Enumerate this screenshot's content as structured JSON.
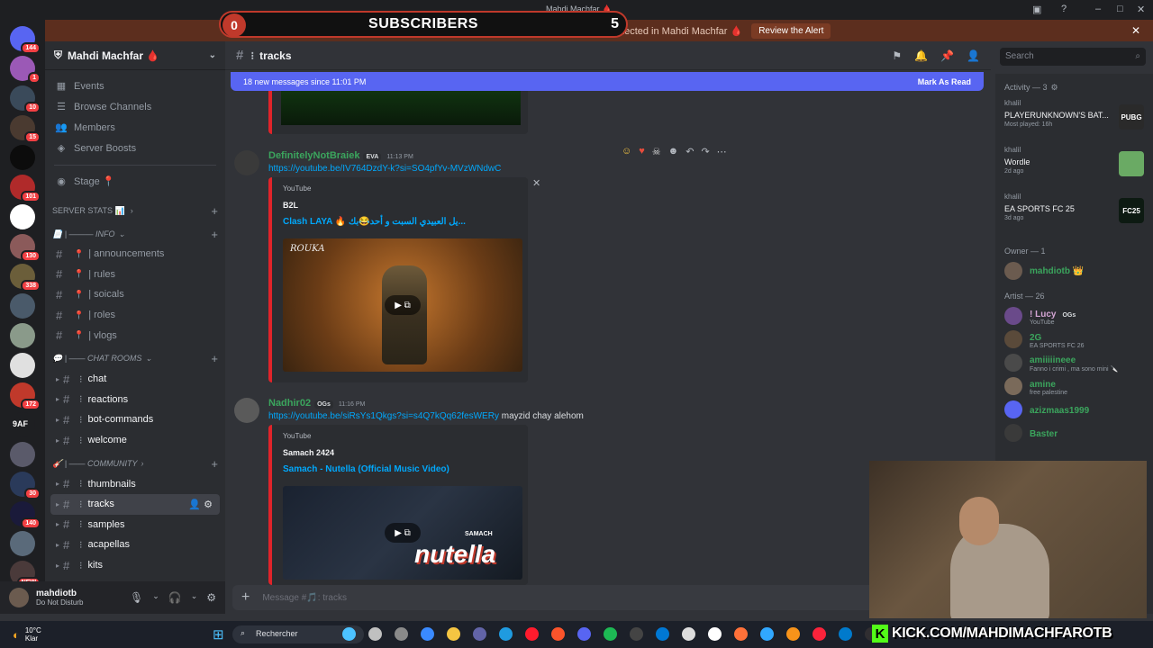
{
  "subscriber_overlay": {
    "left_count": "0",
    "label": "SUBSCRIBERS",
    "right_count": "5"
  },
  "window": {
    "title": "Mahdi Machfar 🩸"
  },
  "alert": {
    "text": "Unusual join activity detected in Mahdi Machfar 🩸",
    "action": "Review the Alert"
  },
  "servers": [
    {
      "badge": "144",
      "color": "#5865f2"
    },
    {
      "badge": "1",
      "color": "#9b59b6"
    },
    {
      "badge": "10",
      "color": "#3a4a5a"
    },
    {
      "badge": "15",
      "color": "#4a3a30"
    },
    {
      "badge": "",
      "color": "#0c0c0c"
    },
    {
      "badge": "101",
      "color": "#b02a2a"
    },
    {
      "badge": "",
      "color": "#ffffff"
    },
    {
      "badge": "130",
      "color": "#8b5a5a"
    },
    {
      "badge": "338",
      "color": "#6b5e3a"
    },
    {
      "badge": "",
      "color": "#4a5a6a"
    },
    {
      "badge": "",
      "color": "#8a9a8a"
    },
    {
      "badge": "",
      "color": "#e0e0e0"
    },
    {
      "badge": "172",
      "color": "#c0392b"
    },
    {
      "badge": "",
      "color": "#1e1f22",
      "text": "9AF"
    },
    {
      "badge": "",
      "color": "#5a5a6a"
    },
    {
      "badge": "30",
      "color": "#2a3a5a"
    },
    {
      "badge": "140",
      "color": "#1a1a3a"
    },
    {
      "badge": "",
      "color": "#5a6a7a"
    },
    {
      "badge": "NEW",
      "color": "#4a3a3a"
    }
  ],
  "server_name": "Mahdi Machfar 🩸",
  "nav": [
    {
      "icon": "calendar",
      "label": "Events"
    },
    {
      "icon": "browse",
      "label": "Browse Channels"
    },
    {
      "icon": "members",
      "label": "Members"
    },
    {
      "icon": "boost",
      "label": "Server Boosts"
    }
  ],
  "stage": {
    "label": "Stage 📍"
  },
  "server_stats": {
    "label": "SERVER STATS 📊"
  },
  "categories": {
    "info": "📄 | ——— INFO",
    "chat_rooms": "💬 | —— CHAT ROOMS",
    "community": "🎸 | —— COMMUNITY"
  },
  "info_channels": [
    {
      "label": "| announcements"
    },
    {
      "label": "| rules"
    },
    {
      "label": "| soicals"
    },
    {
      "label": "| roles"
    },
    {
      "label": "| vlogs"
    }
  ],
  "chat_channels": [
    {
      "label": "chat"
    },
    {
      "label": "reactions"
    },
    {
      "label": "bot-commands"
    },
    {
      "label": "welcome"
    }
  ],
  "community_channels": [
    {
      "label": "thumbnails"
    },
    {
      "label": "tracks"
    },
    {
      "label": "samples"
    },
    {
      "label": "acapellas"
    },
    {
      "label": "kits"
    }
  ],
  "user": {
    "name": "mahdiotb",
    "status": "Do Not Disturb"
  },
  "channel": {
    "name": "tracks"
  },
  "search": {
    "placeholder": "Search"
  },
  "new_banner": {
    "text": "18 new messages since 11:01 PM",
    "action": "Mark As Read"
  },
  "messages": [
    {
      "author": "DefinitelyNotBraiek",
      "tag": "EVA",
      "time": "11:13 PM",
      "link": "https://youtube.be/IV764DzdY-k?si=SO4pfYv-MVzWNdwC",
      "provider": "YouTube",
      "embed_author": "B2L",
      "embed_title": "Clash LAYA 🔥 يل العبيدي السبت و أحد😂بك...",
      "thumb_text": "ROUKA"
    },
    {
      "author": "Nadhir02",
      "tag": "OGs",
      "time": "11:16 PM",
      "link": "https://youtube.be/siRsYs1Qkgs?si=s4Q7kQq62fesWERy",
      "text": "mayzid chay alehom",
      "provider": "YouTube",
      "embed_author": "Samach 2424",
      "embed_title": "Samach - Nutella (Official Music Video)",
      "thumb_text": "nutella",
      "thumb_sub": "SAMACH"
    }
  ],
  "composer": {
    "placeholder": "Message #🎵: tracks"
  },
  "activity": {
    "header": "Activity — 3",
    "items": [
      {
        "user": "khalil",
        "game": "PLAYERUNKNOWN'S BAT...",
        "sub": "Most played: 16h",
        "icon": "PUBG",
        "icon_color": "#2a2a2a"
      },
      {
        "user": "khalil",
        "game": "Wordle",
        "sub": "2d ago",
        "icon": "",
        "icon_color": "#6aaa64"
      },
      {
        "user": "khalil",
        "game": "EA SPORTS FC 25",
        "sub": "3d ago",
        "icon": "FC25",
        "icon_color": "#0d1a12"
      }
    ]
  },
  "owner": {
    "header": "Owner — 1",
    "name": "mahdiotb 👑"
  },
  "artists": {
    "header": "Artist — 26",
    "items": [
      {
        "name": "! Lucy",
        "tag": "OGs",
        "sub": "YouTube",
        "color": "#d4a5d4"
      },
      {
        "name": "2G",
        "tag": "",
        "sub": "EA SPORTS FC 26",
        "color": "#3ba55d"
      },
      {
        "name": "amiiiiineee",
        "tag": "",
        "sub": "Fanno i crimi , ma sono mini 🔪",
        "color": "#3ba55d"
      },
      {
        "name": "amine",
        "tag": "",
        "sub": "free palestine",
        "color": "#3ba55d"
      },
      {
        "name": "azizmaas1999",
        "tag": "",
        "sub": "",
        "color": "#3ba55d"
      },
      {
        "name": "Baster",
        "tag": "",
        "sub": "",
        "color": "#3ba55d"
      }
    ]
  },
  "taskbar": {
    "temp": "10°C",
    "cond": "Klar",
    "search": "Rechercher"
  },
  "kick": {
    "letter": "K",
    "url": "KICK.COM/MAHDIMACHFAROTB"
  }
}
